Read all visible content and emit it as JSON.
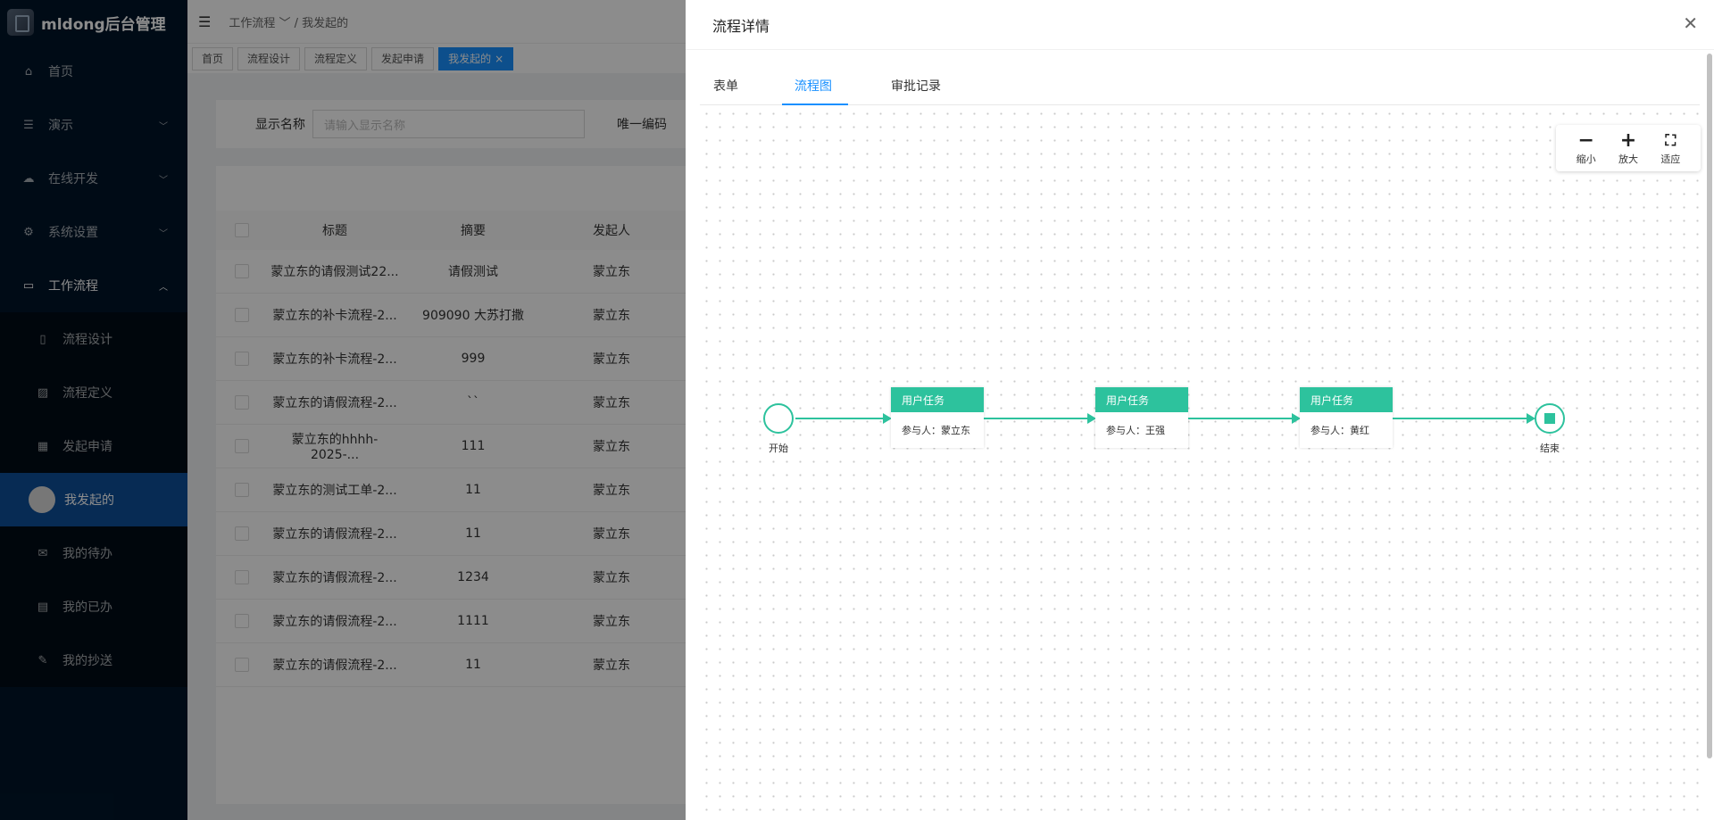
{
  "app": {
    "title": "mldong后台管理"
  },
  "sidebar": {
    "items": [
      {
        "label": "首页",
        "icon": "home-icon"
      },
      {
        "label": "演示",
        "icon": "menu-icon"
      },
      {
        "label": "在线开发",
        "icon": "cloud-icon"
      },
      {
        "label": "系统设置",
        "icon": "gear-icon"
      },
      {
        "label": "工作流程",
        "icon": "laptop-icon"
      }
    ],
    "workflow_items": [
      {
        "label": "流程设计"
      },
      {
        "label": "流程定义"
      },
      {
        "label": "发起申请"
      },
      {
        "label": "我发起的"
      },
      {
        "label": "我的待办"
      },
      {
        "label": "我的已办"
      },
      {
        "label": "我的抄送"
      }
    ]
  },
  "header": {
    "breadcrumb": [
      "工作流程",
      "我发起的"
    ]
  },
  "tabs": [
    "首页",
    "流程设计",
    "流程定义",
    "发起申请",
    "我发起的"
  ],
  "search": {
    "label1": "显示名称",
    "placeholder1": "请输入显示名称",
    "label2": "唯一编码"
  },
  "table": {
    "columns": [
      "标题",
      "摘要",
      "发起人"
    ],
    "rows": [
      [
        "蒙立东的请假测试22...",
        "请假测试",
        "蒙立东"
      ],
      [
        "蒙立东的补卡流程-2...",
        "909090 大苏打撒",
        "蒙立东"
      ],
      [
        "蒙立东的补卡流程-2...",
        "999",
        "蒙立东"
      ],
      [
        "蒙立东的请假流程-2...",
        "``",
        "蒙立东"
      ],
      [
        "蒙立东的hhhh-2025-...",
        "111",
        "蒙立东"
      ],
      [
        "蒙立东的测试工单-2...",
        "11",
        "蒙立东"
      ],
      [
        "蒙立东的请假流程-2...",
        "11",
        "蒙立东"
      ],
      [
        "蒙立东的请假流程-2...",
        "1234",
        "蒙立东"
      ],
      [
        "蒙立东的请假流程-2...",
        "1111",
        "蒙立东"
      ],
      [
        "蒙立东的请假流程-2...",
        "11",
        "蒙立东"
      ]
    ]
  },
  "drawer": {
    "title": "流程详情",
    "tabs": [
      "表单",
      "流程图",
      "审批记录"
    ],
    "active_tab": "流程图",
    "toolbar": {
      "zoom_out": "缩小",
      "zoom_in": "放大",
      "fit": "适应"
    },
    "flow": {
      "start_label": "开始",
      "end_label": "结束",
      "tasks": [
        {
          "title": "用户任务",
          "assignee": "参与人：蒙立东"
        },
        {
          "title": "用户任务",
          "assignee": "参与人：王强"
        },
        {
          "title": "用户任务",
          "assignee": "参与人：黄红"
        }
      ]
    }
  },
  "colors": {
    "sidebar": "#001529",
    "accent": "#1890ff",
    "flow": "#2dc29d"
  }
}
